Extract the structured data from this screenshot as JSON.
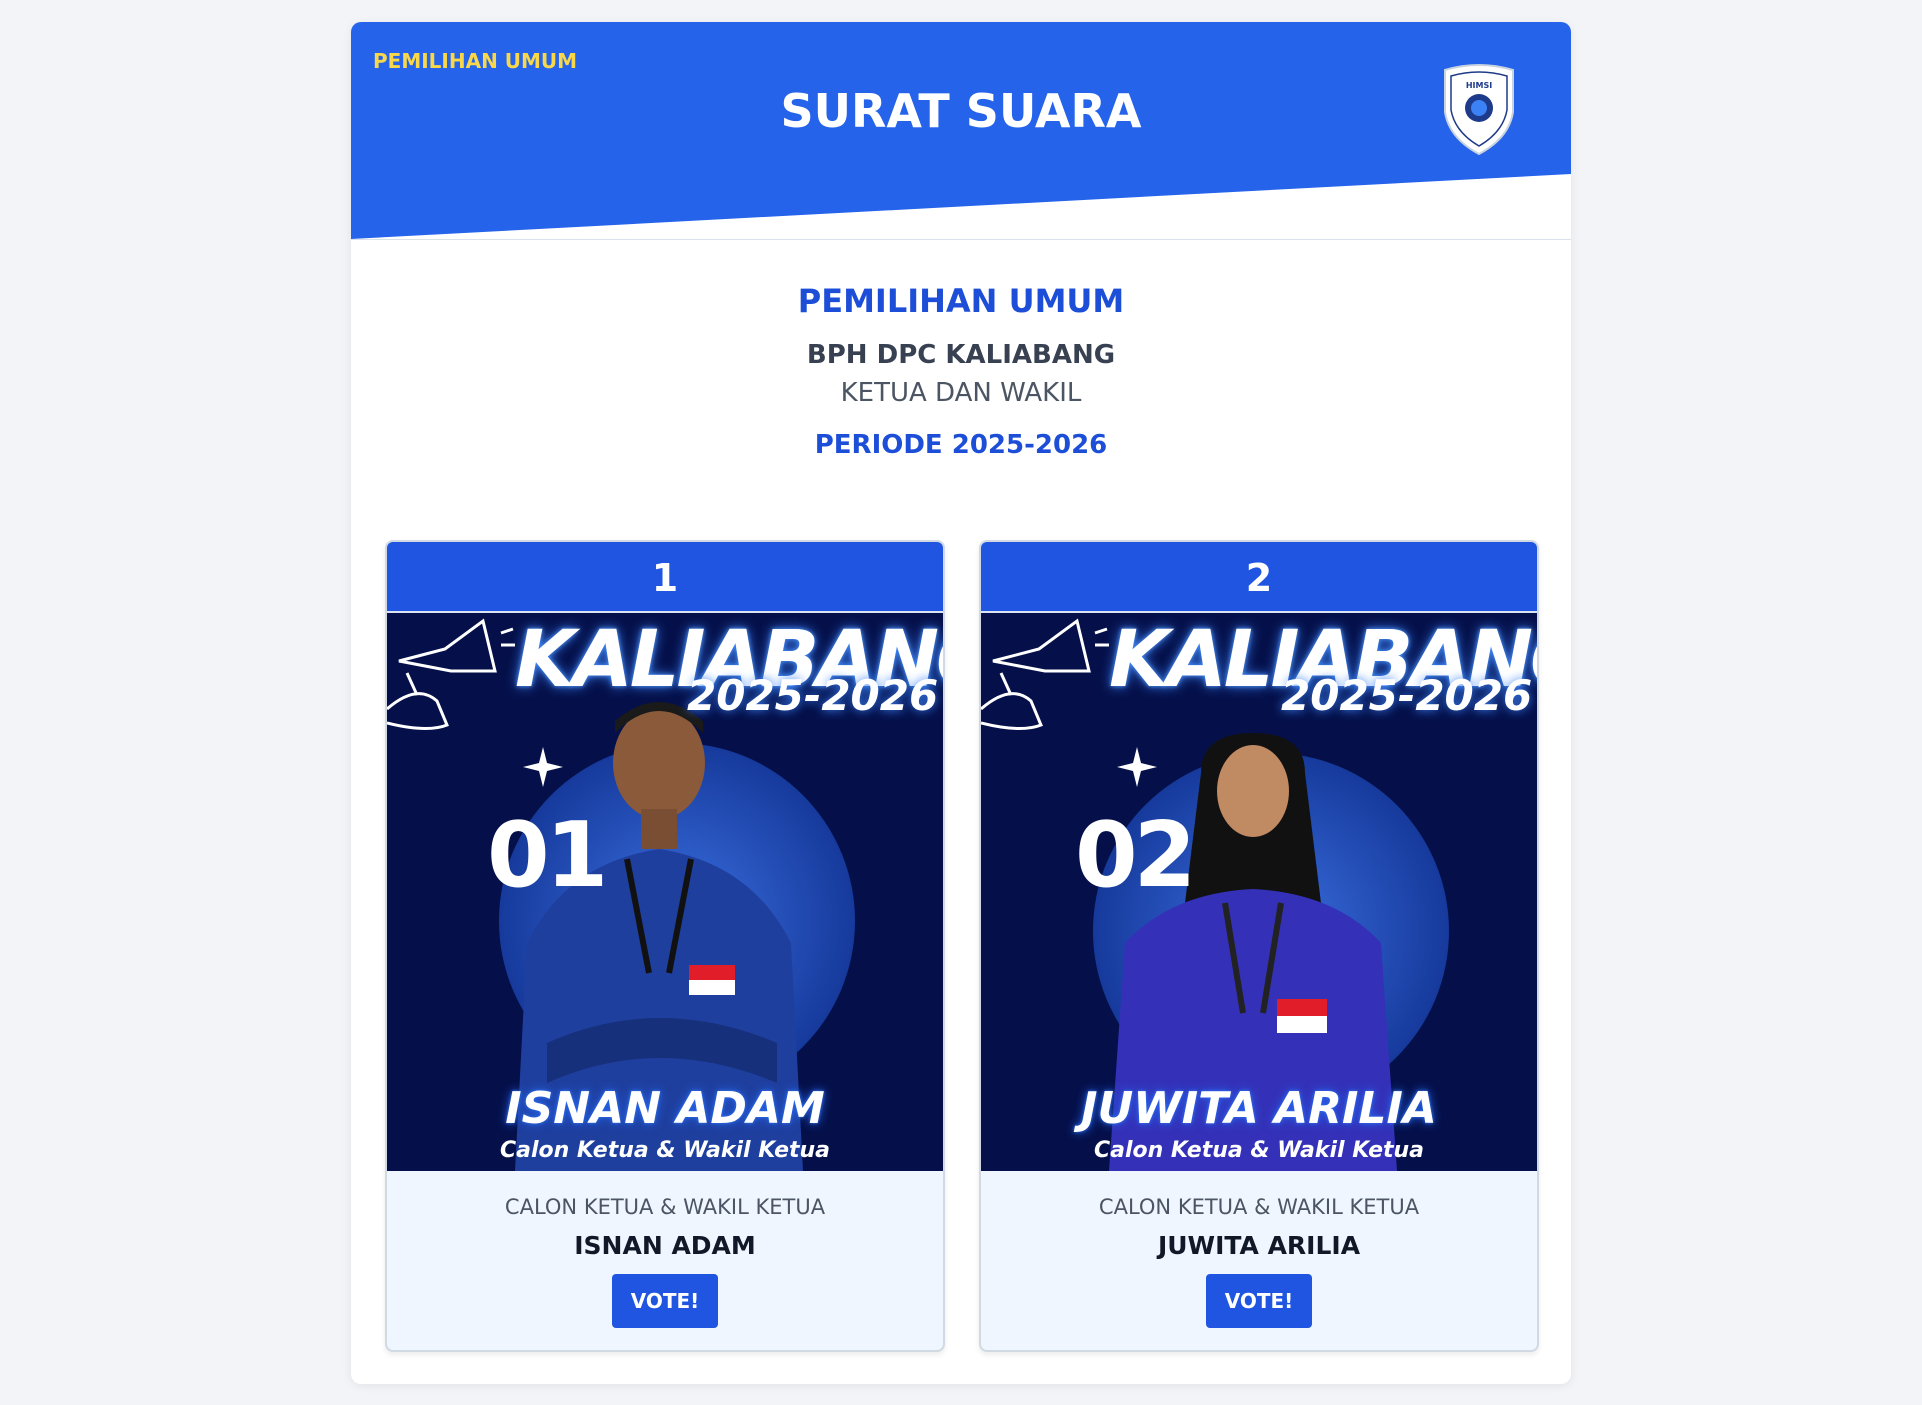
{
  "header": {
    "tag": "PEMILIHAN UMUM",
    "title": "SURAT SUARA",
    "logo_text": "HIMSI",
    "blue": "#2563eb"
  },
  "intro": {
    "title": "PEMILIHAN UMUM",
    "organization": "BPH DPC KALIABANG",
    "role": "KETUA DAN WAKIL",
    "period": "PERIODE 2025-2026"
  },
  "candidates": [
    {
      "number": "1",
      "poster": {
        "title": "KALIABANG",
        "year": "2025-2026",
        "ballot_no": "01",
        "name": "ISNAN ADAM",
        "subtitle": "Calon Ketua & Wakil Ketua"
      },
      "role": "CALON KETUA & WAKIL KETUA",
      "name": "ISNAN ADAM",
      "vote_label": "VOTE!"
    },
    {
      "number": "2",
      "poster": {
        "title": "KALIABANG",
        "year": "2025-2026",
        "ballot_no": "02",
        "name": "JUWITA ARILIA",
        "subtitle": "Calon Ketua & Wakil Ketua"
      },
      "role": "CALON KETUA & WAKIL KETUA",
      "name": "JUWITA ARILIA",
      "vote_label": "VOTE!"
    }
  ]
}
